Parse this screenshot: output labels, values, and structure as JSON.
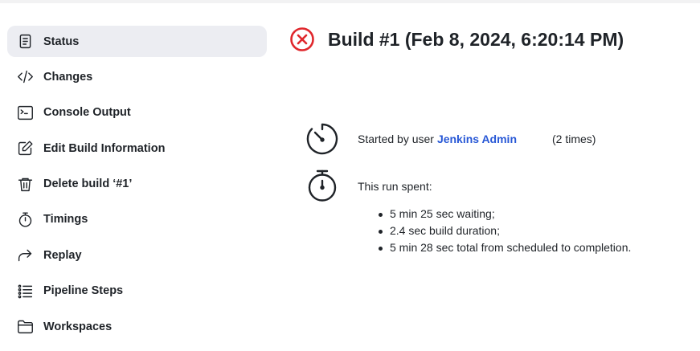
{
  "sidebar": {
    "items": [
      {
        "label": "Status",
        "icon": "document-icon",
        "active": true
      },
      {
        "label": "Changes",
        "icon": "code-icon"
      },
      {
        "label": "Console Output",
        "icon": "terminal-icon"
      },
      {
        "label": "Edit Build Information",
        "icon": "edit-icon"
      },
      {
        "label": "Delete build ‘#1’",
        "icon": "trash-icon"
      },
      {
        "label": "Timings",
        "icon": "stopwatch-icon"
      },
      {
        "label": "Replay",
        "icon": "replay-arrow-icon"
      },
      {
        "label": "Pipeline Steps",
        "icon": "list-icon"
      },
      {
        "label": "Workspaces",
        "icon": "folder-icon"
      }
    ]
  },
  "build": {
    "status_icon": "failed-x-circle-icon",
    "status_color": "#e0272c",
    "title": "Build #1 (Feb 8, 2024, 6:20:14 PM)"
  },
  "started": {
    "prefix": "Started by user",
    "user": "Jenkins Admin",
    "count": "(2 times)"
  },
  "spent": {
    "title": "This run spent:",
    "items": [
      "5 min 25 sec waiting;",
      "2.4 sec build duration;",
      "5 min 28 sec total from scheduled to completion."
    ]
  },
  "colors": {
    "link": "#2858d6",
    "active_bg": "#ecedf2"
  }
}
